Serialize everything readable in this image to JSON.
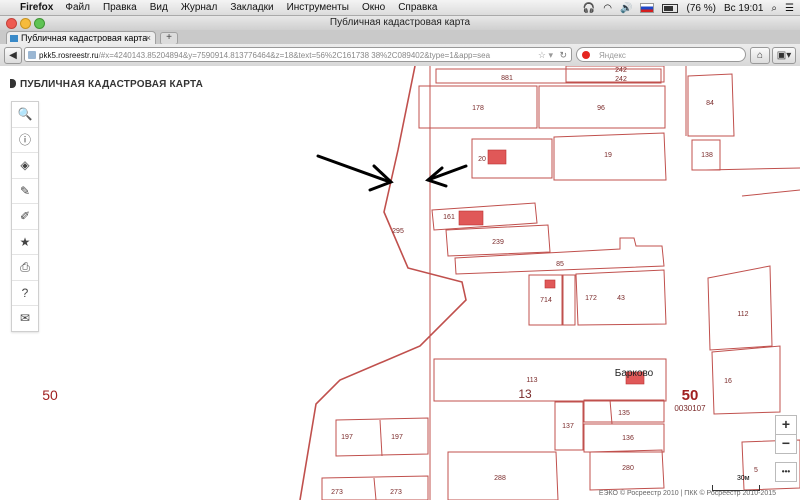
{
  "menubar": {
    "app": "Firefox",
    "items": [
      "Файл",
      "Правка",
      "Вид",
      "Журнал",
      "Закладки",
      "Инструменты",
      "Окно",
      "Справка"
    ],
    "battery": "(76 %)",
    "clock": "Вс 19:01"
  },
  "window": {
    "title": "Публичная кадастровая карта"
  },
  "tab": {
    "label": "Публичная кадастровая карта"
  },
  "nav": {
    "url_host": "pkk5.rosreestr.ru",
    "url_rest": "/#x=4240143.85204894&y=7590914.813776464&z=18&text=56%2C161738 38%2C089402&type=1&app=sea",
    "search_placeholder": "Яндекс"
  },
  "app": {
    "logo": "ПУБЛИЧНАЯ КАДАСТРОВАЯ КАРТА",
    "tools": [
      {
        "name": "search-icon",
        "glyph": "🔍"
      },
      {
        "name": "info-icon",
        "glyph": "ⓘ"
      },
      {
        "name": "layers-icon",
        "glyph": "◈"
      },
      {
        "name": "pencil-icon",
        "glyph": "✎"
      },
      {
        "name": "measure-icon",
        "glyph": "✐"
      },
      {
        "name": "star-icon",
        "glyph": "★"
      },
      {
        "name": "print-icon",
        "glyph": "⎙"
      },
      {
        "name": "help-icon",
        "glyph": "?"
      },
      {
        "name": "mail-icon",
        "glyph": "✉"
      }
    ],
    "zoom_in": "+",
    "zoom_out": "−",
    "more": "•••"
  },
  "map": {
    "labels": [
      {
        "text": "881"
      },
      {
        "text": "242"
      },
      {
        "text": "242"
      },
      {
        "text": "84"
      },
      {
        "text": "178"
      },
      {
        "text": "96"
      },
      {
        "text": "20"
      },
      {
        "text": "19"
      },
      {
        "text": "138"
      },
      {
        "text": "161"
      },
      {
        "text": "295"
      },
      {
        "text": "239"
      },
      {
        "text": "85"
      },
      {
        "text": "714"
      },
      {
        "text": "172"
      },
      {
        "text": "43"
      },
      {
        "text": "112"
      },
      {
        "text": "113"
      },
      {
        "text": "13"
      },
      {
        "text": "16"
      },
      {
        "text": "135"
      },
      {
        "text": "137"
      },
      {
        "text": "136"
      },
      {
        "text": "197"
      },
      {
        "text": "197"
      },
      {
        "text": "288"
      },
      {
        "text": "280"
      },
      {
        "text": "273"
      },
      {
        "text": "273"
      },
      {
        "text": "5"
      },
      {
        "text": "0030107"
      },
      {
        "text": "50"
      },
      {
        "text": "50"
      }
    ],
    "village": "Барково",
    "scale": "30м",
    "credits": "ЕЭКО © Росреестр 2010 | ПКК © Росреестр 2010-2015",
    "line_color": "#c0504d",
    "building_color": "#e05858"
  }
}
